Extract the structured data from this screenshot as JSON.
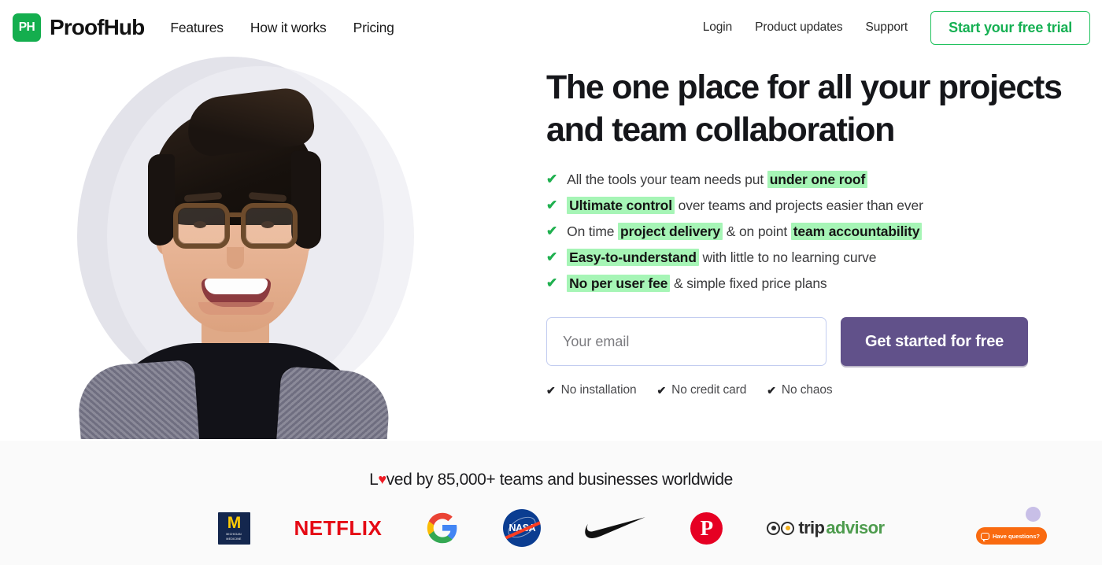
{
  "header": {
    "brand_mark": "PH",
    "brand_name": "ProofHub",
    "nav": [
      {
        "label": "Features"
      },
      {
        "label": "How it works"
      },
      {
        "label": "Pricing"
      }
    ],
    "nav_right": [
      {
        "label": "Login"
      },
      {
        "label": "Product updates"
      },
      {
        "label": "Support"
      }
    ],
    "trial_button": "Start your free trial",
    "accent_green": "#16b053"
  },
  "hero": {
    "headline": "The one place for all your projects and team collaboration",
    "benefits": [
      {
        "pre": "All the tools your team needs put ",
        "highlight": "under one roof",
        "post": ""
      },
      {
        "pre": "",
        "highlight": "Ultimate control",
        "post": " over teams and projects easier than ever"
      },
      {
        "pre": "On time ",
        "highlight": "project delivery",
        "post": " & on point ",
        "highlight2": "team accountability"
      },
      {
        "pre": "",
        "highlight": "Easy-to-understand",
        "post": " with little to no learning curve"
      },
      {
        "pre": "",
        "highlight": "No per user fee",
        "post": " & simple fixed price plans"
      }
    ],
    "highlight_color": "#a6f5b6",
    "tick_color": "#1fb04f",
    "email_placeholder": "Your email",
    "email_value": "",
    "cta_label": "Get started for free",
    "cta_color": "#61518a",
    "assurances": [
      {
        "label": "No installation"
      },
      {
        "label": "No credit card"
      },
      {
        "label": "No chaos"
      }
    ]
  },
  "social_proof": {
    "loved_prefix": "L",
    "loved_heart": "♥",
    "loved_suffix": "ved by 85,000+ teams and businesses worldwide",
    "logos": [
      {
        "name": "Michigan Medicine",
        "mark": "M",
        "sub_line1": "MICHIGAN",
        "sub_line2": "MEDICINE"
      },
      {
        "name": "Netflix",
        "wordmark": "NETFLIX"
      },
      {
        "name": "Google",
        "mark": "G"
      },
      {
        "name": "NASA",
        "wordmark": "NASA"
      },
      {
        "name": "Nike",
        "mark": "swoosh"
      },
      {
        "name": "Pinterest",
        "mark": "P"
      },
      {
        "name": "Tripadvisor",
        "word1": "trip",
        "word2": "advisor"
      }
    ]
  },
  "chat_widget": {
    "label": "Have questions?",
    "color": "#f96a10"
  }
}
